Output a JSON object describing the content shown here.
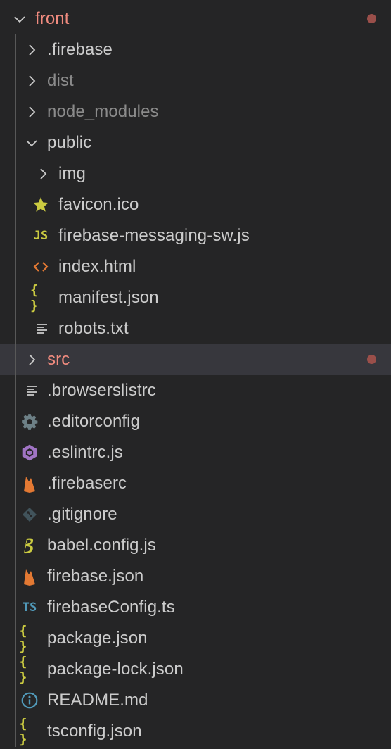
{
  "explorer": {
    "root": {
      "name": "front",
      "expanded": true,
      "modified": true,
      "icon": "chevron-down-icon"
    },
    "items": [
      {
        "name": ".firebase",
        "type": "folder",
        "expanded": false,
        "icon": "chevron-right-icon"
      },
      {
        "name": "dist",
        "type": "folder",
        "expanded": false,
        "ignored": true,
        "icon": "chevron-right-icon"
      },
      {
        "name": "node_modules",
        "type": "folder",
        "expanded": false,
        "ignored": true,
        "icon": "chevron-right-icon"
      },
      {
        "name": "public",
        "type": "folder",
        "expanded": true,
        "icon": "chevron-down-icon",
        "children": [
          {
            "name": "img",
            "type": "folder",
            "expanded": false,
            "icon": "chevron-right-icon"
          },
          {
            "name": "favicon.ico",
            "type": "file",
            "icon": "star-icon"
          },
          {
            "name": "firebase-messaging-sw.js",
            "type": "file",
            "icon": "javascript-icon",
            "icon_text": "JS"
          },
          {
            "name": "index.html",
            "type": "file",
            "icon": "html-icon"
          },
          {
            "name": "manifest.json",
            "type": "file",
            "icon": "json-icon",
            "icon_text": "{ }"
          },
          {
            "name": "robots.txt",
            "type": "file",
            "icon": "text-file-icon"
          }
        ]
      },
      {
        "name": "src",
        "type": "folder",
        "expanded": false,
        "modified": true,
        "selected": true,
        "icon": "chevron-right-icon"
      },
      {
        "name": ".browserslistrc",
        "type": "file",
        "icon": "text-file-icon"
      },
      {
        "name": ".editorconfig",
        "type": "file",
        "icon": "gear-icon"
      },
      {
        "name": ".eslintrc.js",
        "type": "file",
        "icon": "eslint-icon"
      },
      {
        "name": ".firebaserc",
        "type": "file",
        "icon": "firebase-icon"
      },
      {
        "name": ".gitignore",
        "type": "file",
        "icon": "git-icon"
      },
      {
        "name": "babel.config.js",
        "type": "file",
        "icon": "babel-icon"
      },
      {
        "name": "firebase.json",
        "type": "file",
        "icon": "firebase-icon"
      },
      {
        "name": "firebaseConfig.ts",
        "type": "file",
        "icon": "typescript-icon",
        "icon_text": "TS"
      },
      {
        "name": "package.json",
        "type": "file",
        "icon": "json-icon",
        "icon_text": "{ }"
      },
      {
        "name": "package-lock.json",
        "type": "file",
        "icon": "json-icon",
        "icon_text": "{ }"
      },
      {
        "name": "README.md",
        "type": "file",
        "icon": "info-icon"
      },
      {
        "name": "tsconfig.json",
        "type": "file",
        "icon": "json-icon",
        "icon_text": "{ }"
      }
    ]
  },
  "colors": {
    "background": "#252526",
    "selected_row": "#37373d",
    "text": "#cccccc",
    "modified_text": "#f08b7f",
    "ignored_text": "#8b8b8b",
    "modified_dot": "#9a4f4a",
    "json_yellow": "#cbcb41",
    "js_yellow": "#cbcb41",
    "ts_blue": "#519aba",
    "html_orange": "#e37933",
    "firebase_orange": "#e37933",
    "eslint_purple": "#a074c4",
    "gear_gray": "#6d8086",
    "git_gray": "#41535b",
    "info_blue": "#519aba"
  }
}
